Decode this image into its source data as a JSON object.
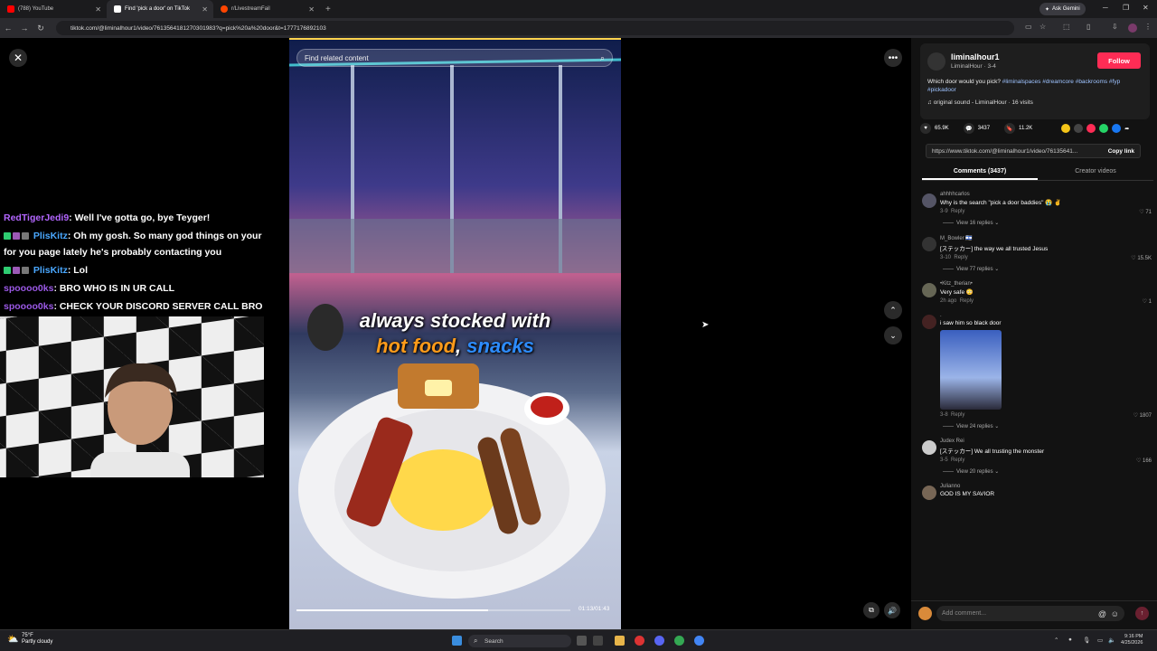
{
  "browser": {
    "tabs": [
      {
        "label": "(788) YouTube",
        "color": "#ff0000"
      },
      {
        "label": "Find 'pick a door' on TikTok",
        "color": "#ffffff"
      },
      {
        "label": "r/LivestreamFail",
        "color": "#ff4500"
      }
    ],
    "new_tab": "+",
    "gemini_label": "Ask Gemini",
    "url": "tiktok.com/@liminalhour1/video/7613564181270301983?q=pick%20a%20door&t=1777176892103"
  },
  "stream_chat": [
    {
      "user": "RedTigerJedi9",
      "text": ": Well I've gotta go, bye Teyger!",
      "badges": false,
      "color": "#b366ff"
    },
    {
      "user": "PlisKitz",
      "text": ": Oh my gosh. So many god things on your for you page lately he's probably contacting you",
      "badges": true,
      "color": "#4aa8ff"
    },
    {
      "user": "PlisKitz",
      "text": ": Lol",
      "badges": true,
      "color": "#4aa8ff"
    },
    {
      "user": "spoooo0ks",
      "text": ": BRO WHO IS IN UR CALL",
      "badges": false,
      "color": "#9b59e6"
    },
    {
      "user": "spoooo0ks",
      "text": ": CHECK YOUR DISCORD SERVER CALL BRO",
      "badges": false,
      "color": "#9b59e6"
    }
  ],
  "video": {
    "search_placeholder": "Find related content",
    "caption_line1": "always stocked with",
    "caption_word1": "hot food",
    "caption_sep": ", ",
    "caption_word2": "snacks",
    "time": "01:13/01:43",
    "progress": 0.7
  },
  "post": {
    "username": "liminalhour1",
    "sub": "LiminalHour · 3-4",
    "follow": "Follow",
    "desc_text": "Which door would you pick?",
    "hashtags": [
      "#liminalspaces",
      "#dreamcore",
      "#backrooms",
      "#fyp",
      "#pickadoor"
    ],
    "sound": "original sound - LiminalHour · 16 visits",
    "likes": "65.9K",
    "comments_count": "3437",
    "saves": "11.2K",
    "link": "https://www.tiktok.com/@liminalhour1/video/76135641...",
    "copy_link": "Copy link"
  },
  "tabs": {
    "comments": "Comments (3437)",
    "creator": "Creator videos"
  },
  "comments": [
    {
      "name": "ahhhhcarlos",
      "text": "Why is the search \"pick a door baddies\" 😭 ✌️",
      "date": "3-9",
      "reply": "Reply",
      "likes": "71",
      "replies": "View 16 replies ⌄",
      "image": false
    },
    {
      "name": "M_Bowler 🇮🇱",
      "text": "[ステッカー] the way we all trusted Jesus",
      "date": "3-10",
      "reply": "Reply",
      "likes": "15.5K",
      "replies": "View 77 replies ⌄",
      "image": false
    },
    {
      "name": "•Kitz_therian•",
      "text": "Very safe 😳",
      "date": "2h ago",
      "reply": "Reply",
      "likes": "1",
      "replies": "",
      "image": false
    },
    {
      "name": ".",
      "text": "i saw him so black door",
      "date": "3-8",
      "reply": "Reply",
      "likes": "1807",
      "replies": "View 24 replies ⌄",
      "image": true
    },
    {
      "name": "Judex Rei",
      "text": "[ステッカー] We all trusting the monster",
      "date": "3-5",
      "reply": "Reply",
      "likes": "166",
      "replies": "View 20 replies ⌄",
      "image": false
    },
    {
      "name": "Julianno",
      "text": "GOD IS MY SAVIOR",
      "date": "",
      "reply": "",
      "likes": "",
      "replies": "",
      "image": false
    }
  ],
  "add_comment_placeholder": "Add comment...",
  "taskbar": {
    "temp": "75°F",
    "weather": "Partly cloudy",
    "search": "Search",
    "time": "9:16 PM",
    "date": "4/25/2026"
  },
  "colors": {
    "accent": "#fe2c55",
    "hashtag": "#9ec3ff"
  }
}
